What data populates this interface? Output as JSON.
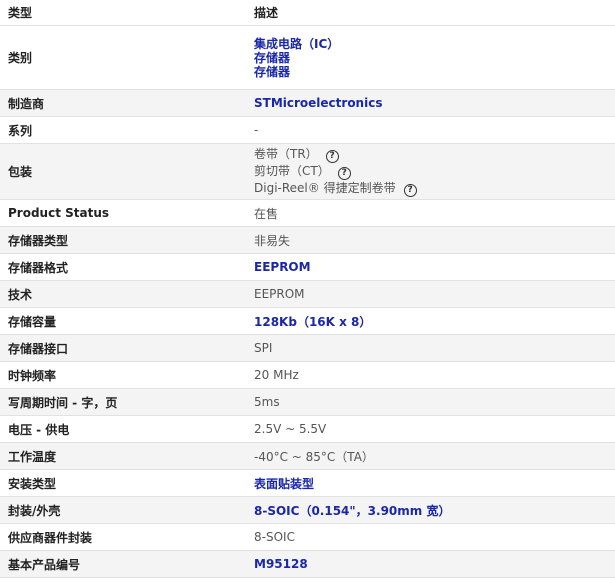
{
  "header": {
    "type_label": "类型",
    "desc_label": "描述"
  },
  "rows": {
    "category": {
      "label": "类别",
      "values": [
        "集成电路（IC）",
        "存储器",
        "存储器"
      ]
    },
    "manufacturer": {
      "label": "制造商",
      "value": "STMicroelectronics"
    },
    "series": {
      "label": "系列",
      "value": "-"
    },
    "packaging": {
      "label": "包装",
      "options": [
        "卷带（TR）",
        "剪切带（CT）",
        "Digi-Reel® 得捷定制卷带"
      ],
      "help_glyph": "?"
    },
    "product_status": {
      "label": "Product Status",
      "value": "在售"
    },
    "memory_type": {
      "label": "存储器类型",
      "value": "非易失"
    },
    "memory_format": {
      "label": "存储器格式",
      "value": "EEPROM"
    },
    "technology": {
      "label": "技术",
      "value": "EEPROM"
    },
    "memory_size": {
      "label": "存储容量",
      "value": "128Kb（16K x 8）"
    },
    "memory_interface": {
      "label": "存储器接口",
      "value": "SPI"
    },
    "clock_frequency": {
      "label": "时钟频率",
      "value": "20 MHz"
    },
    "write_cycle_time": {
      "label": "写周期时间 - 字，页",
      "value": "5ms"
    },
    "voltage_supply": {
      "label": "电压 - 供电",
      "value": "2.5V ~ 5.5V"
    },
    "operating_temperature": {
      "label": "工作温度",
      "value": "-40°C ~ 85°C（TA）"
    },
    "mounting_type": {
      "label": "安装类型",
      "value": "表面贴装型"
    },
    "package_case": {
      "label": "封装/外壳",
      "value": "8-SOIC（0.154\"，3.90mm 宽）"
    },
    "supplier_device_package": {
      "label": "供应商器件封装",
      "value": "8-SOIC"
    },
    "base_product_number": {
      "label": "基本产品编号",
      "value": "M95128"
    }
  },
  "colors": {
    "link": "#1a27a8",
    "shade": "#f4f4f4",
    "border": "#e2e2e2"
  }
}
